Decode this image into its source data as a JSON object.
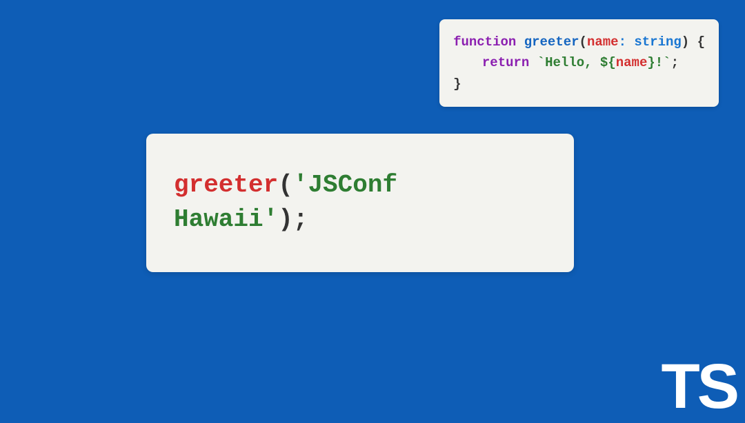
{
  "small_code": {
    "line1": {
      "keyword": "function",
      "space1": " ",
      "func": "greeter",
      "open_paren": "(",
      "param": "name",
      "colon_type": ": string",
      "close_paren_brace": ") {"
    },
    "line2": {
      "keyword": "return",
      "space1": " ",
      "tpl_open": "`Hello, ${",
      "var": "name",
      "tpl_close": "}!`",
      "semi": ";"
    },
    "line3": "}"
  },
  "large_code": {
    "func": "greeter",
    "open_paren": "(",
    "string": "'JSConf Hawaii'",
    "close": ");"
  },
  "logo": "TS"
}
